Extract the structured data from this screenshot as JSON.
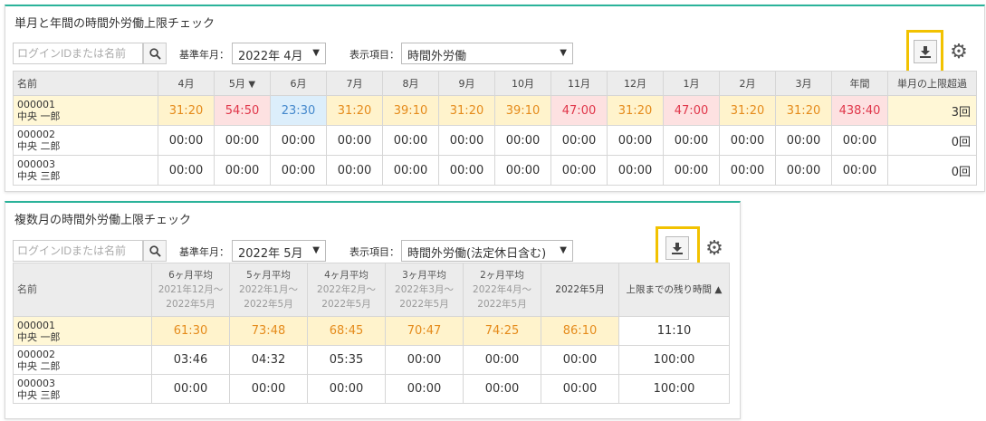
{
  "panel1": {
    "title": "単月と年間の時間外労働上限チェック",
    "search_placeholder": "ログインIDまたは名前",
    "base_label": "基準年月：",
    "base_value": "2022年 4月",
    "display_label": "表示項目：",
    "display_value": "時間外労働",
    "headers": [
      "名前",
      "4月",
      "5月",
      "6月",
      "7月",
      "8月",
      "9月",
      "10月",
      "11月",
      "12月",
      "1月",
      "2月",
      "3月",
      "年間",
      "単月の上限超過"
    ],
    "rows": [
      {
        "id": "000001",
        "name": "中央 一郎",
        "values": [
          "31:20",
          "54:50",
          "23:30",
          "31:20",
          "39:10",
          "31:20",
          "39:10",
          "47:00",
          "31:20",
          "47:00",
          "31:20",
          "31:20",
          "438:40"
        ],
        "count": "3回"
      },
      {
        "id": "000002",
        "name": "中央 二郎",
        "values": [
          "00:00",
          "00:00",
          "00:00",
          "00:00",
          "00:00",
          "00:00",
          "00:00",
          "00:00",
          "00:00",
          "00:00",
          "00:00",
          "00:00",
          "00:00"
        ],
        "count": "0回"
      },
      {
        "id": "000003",
        "name": "中央 三郎",
        "values": [
          "00:00",
          "00:00",
          "00:00",
          "00:00",
          "00:00",
          "00:00",
          "00:00",
          "00:00",
          "00:00",
          "00:00",
          "00:00",
          "00:00",
          "00:00"
        ],
        "count": "0回"
      }
    ]
  },
  "panel2": {
    "title": "複数月の時間外労働上限チェック",
    "search_placeholder": "ログインIDまたは名前",
    "base_label": "基準年月：",
    "base_value": "2022年 5月",
    "display_label": "表示項目：",
    "display_value": "時間外労働(法定休日含む)",
    "headers": [
      {
        "main": "名前"
      },
      {
        "main": "6ヶ月平均",
        "sub1": "2021年12月～",
        "sub2": "2022年5月"
      },
      {
        "main": "5ヶ月平均",
        "sub1": "2022年1月～",
        "sub2": "2022年5月"
      },
      {
        "main": "4ヶ月平均",
        "sub1": "2022年2月～",
        "sub2": "2022年5月"
      },
      {
        "main": "3ヶ月平均",
        "sub1": "2022年3月～",
        "sub2": "2022年5月"
      },
      {
        "main": "2ヶ月平均",
        "sub1": "2022年4月～",
        "sub2": "2022年5月"
      },
      {
        "main": "2022年5月"
      },
      {
        "main": "上限までの残り時間 ▲"
      }
    ],
    "rows": [
      {
        "id": "000001",
        "name": "中央 一郎",
        "values": [
          "61:30",
          "73:48",
          "68:45",
          "70:47",
          "74:25",
          "86:10"
        ],
        "remain": "11:10"
      },
      {
        "id": "000002",
        "name": "中央 二郎",
        "values": [
          "03:46",
          "04:32",
          "05:35",
          "00:00",
          "00:00",
          "00:00"
        ],
        "remain": "100:00"
      },
      {
        "id": "000003",
        "name": "中央 三郎",
        "values": [
          "00:00",
          "00:00",
          "00:00",
          "00:00",
          "00:00",
          "00:00"
        ],
        "remain": "100:00"
      }
    ]
  },
  "colors": {
    "accent": "#2bb39a",
    "highlight": "#f2c200",
    "warn_orange": "#e58b1b",
    "warn_red": "#e0364a",
    "ok_blue": "#4488cc"
  },
  "icons": {
    "search": "search-icon",
    "download": "download-icon",
    "settings": "gear-icon",
    "dropdown": "chevron-down-icon",
    "sort": "sort-down-icon"
  }
}
